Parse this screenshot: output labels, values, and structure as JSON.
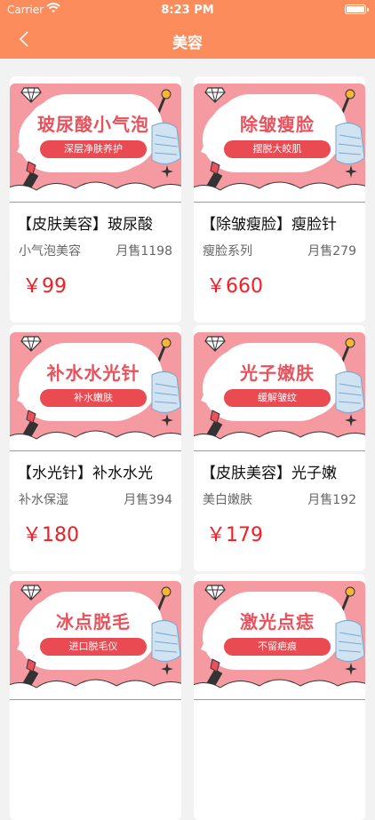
{
  "status_bar": {
    "carrier": "Carrier",
    "time": "8:23 PM"
  },
  "nav": {
    "title": "美容",
    "back_icon": "chevron-left-icon"
  },
  "colors": {
    "header": "#fc8c5c",
    "price": "#f31d23",
    "banner": "#f49aa0",
    "pill": "#ea4a52"
  },
  "products": [
    {
      "name": "【皮肤美容】玻尿酸",
      "subtitle": "小气泡美容",
      "sales": "月售1198",
      "price": "￥99",
      "banner_title": "玻尿酸小气泡",
      "banner_tag": "深层净肤养护"
    },
    {
      "name": "【除皱瘦脸】瘦脸针",
      "subtitle": "瘦脸系列",
      "sales": "月售279",
      "price": "￥660",
      "banner_title": "除皱瘦脸",
      "banner_tag": "摆脱大皎肌"
    },
    {
      "name": "【水光针】补水水光",
      "subtitle": "补水保湿",
      "sales": "月售394",
      "price": "￥180",
      "banner_title": "补水水光针",
      "banner_tag": "补水嫩肤"
    },
    {
      "name": "【皮肤美容】光子嫩",
      "subtitle": "美白嫩肤",
      "sales": "月售192",
      "price": "￥179",
      "banner_title": "光子嫩肤",
      "banner_tag": "缓解皱纹"
    },
    {
      "name": "",
      "subtitle": "",
      "sales": "",
      "price": "",
      "banner_title": "冰点脱毛",
      "banner_tag": "进口脱毛仪"
    },
    {
      "name": "",
      "subtitle": "",
      "sales": "",
      "price": "",
      "banner_title": "激光点痣",
      "banner_tag": "不留疤痕"
    }
  ]
}
